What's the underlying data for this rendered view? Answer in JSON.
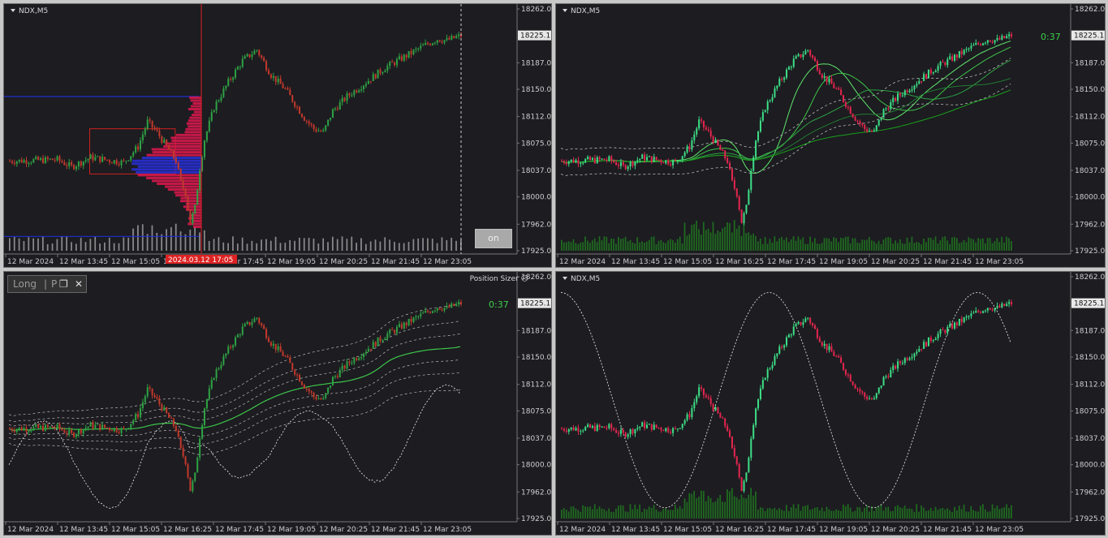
{
  "symbol": "NDX,M5",
  "price_axis": [
    "18262.0",
    "18225.1",
    "18187.0",
    "18150.0",
    "18112.0",
    "18075.0",
    "18037.0",
    "18000.0",
    "17962.0",
    "17925.0"
  ],
  "current_price": "18225.1",
  "time_axis": [
    "12 Mar 2024",
    "12 Mar 13:45",
    "12 Mar 15:05",
    "12 Mar 16:25",
    "12 Mar 17:45",
    "12 Mar 19:05",
    "12 Mar 20:25",
    "12 Mar 21:45",
    "12 Mar 23:05"
  ],
  "crosshair_label": "2024.03.12 17:05",
  "countdown": "0:37",
  "on_button": "on",
  "position_sizer": {
    "title": "Position Sizer",
    "direction": "Long",
    "sep": "|",
    "p": "P",
    "restore_glyph": "❐",
    "close_glyph": "✕",
    "smile_glyph": "☹"
  },
  "colors": {
    "bull": "#2ea043",
    "bear": "#c0392b",
    "mint": "#3ddc84",
    "crimson": "#e2264d",
    "bg": "#1c1c21",
    "grid": "#2a2a30",
    "axis": "#cfcfcf"
  }
}
